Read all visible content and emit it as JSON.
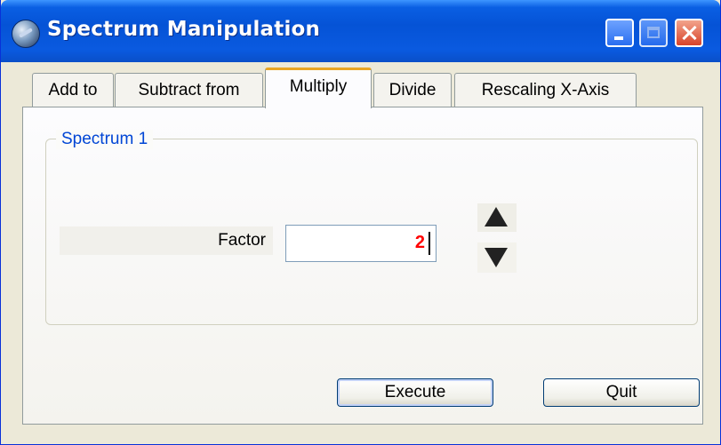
{
  "window": {
    "title": "Spectrum Manipulation"
  },
  "titlebar_buttons": {
    "minimize": "minimize-icon",
    "maximize": "maximize-icon",
    "close": "close-icon"
  },
  "tabs": [
    {
      "label": "Add to",
      "active": false
    },
    {
      "label": "Subtract from",
      "active": false
    },
    {
      "label": "Multiply",
      "active": true
    },
    {
      "label": "Divide",
      "active": false
    },
    {
      "label": "Rescaling X-Axis",
      "active": false
    }
  ],
  "group": {
    "title": "Spectrum 1"
  },
  "factor": {
    "label": "Factor",
    "value": "2"
  },
  "spinner": {
    "up_icon": "triangle-up-icon",
    "down_icon": "triangle-down-icon"
  },
  "buttons": {
    "execute": "Execute",
    "quit": "Quit"
  },
  "colors": {
    "accent": "#0046d5",
    "value": "#ff0000",
    "titlebar": "#0553d6",
    "tab_highlight": "#e8a524"
  }
}
